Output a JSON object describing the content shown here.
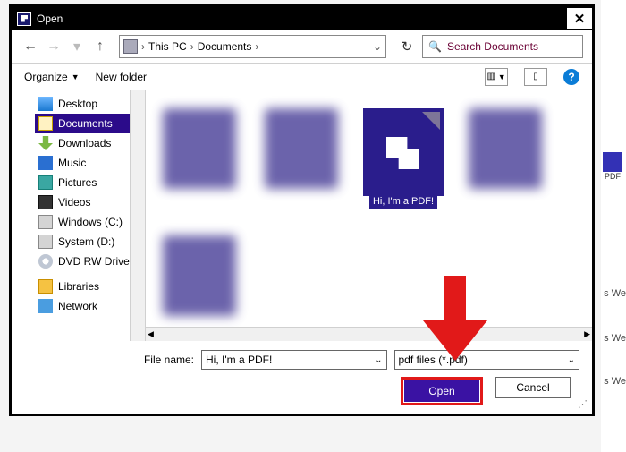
{
  "dialog": {
    "title": "Open",
    "closeGlyph": "✕"
  },
  "nav": {
    "back": "←",
    "fwd": "→",
    "drop": "▾",
    "up": "↑",
    "breadcrumb": [
      "This PC",
      "Documents"
    ],
    "bcDrop": "⌄",
    "refresh": "↻",
    "searchPlaceholder": "Search Documents"
  },
  "toolbar": {
    "organize": "Organize",
    "newfolder": "New folder",
    "viewGlyph": "▥",
    "paneGlyph": "▯",
    "help": "?"
  },
  "tree": {
    "items": [
      {
        "label": "Desktop",
        "ico": "ico-desktop"
      },
      {
        "label": "Documents",
        "ico": "ico-docs",
        "selected": true
      },
      {
        "label": "Downloads",
        "ico": "ico-dl"
      },
      {
        "label": "Music",
        "ico": "ico-music"
      },
      {
        "label": "Pictures",
        "ico": "ico-pic"
      },
      {
        "label": "Videos",
        "ico": "ico-vid"
      },
      {
        "label": "Windows (C:)",
        "ico": "ico-drive"
      },
      {
        "label": "System (D:)",
        "ico": "ico-drive"
      },
      {
        "label": "DVD RW Drive",
        "ico": "ico-dvd"
      },
      {
        "label": "Libraries",
        "ico": "ico-lib"
      },
      {
        "label": "Network",
        "ico": "ico-net"
      }
    ]
  },
  "files": {
    "selectedLabel": "Hi, I'm a PDF!"
  },
  "bottom": {
    "fileNameLabel": "File name:",
    "fileNameValue": "Hi, I'm a PDF!",
    "filterValue": "pdf files (*.pdf)",
    "open": "Open",
    "cancel": "Cancel"
  },
  "bg": {
    "pdfLabel": "PDF",
    "s1": "s We",
    "s2": "s We",
    "s3": "s We"
  }
}
